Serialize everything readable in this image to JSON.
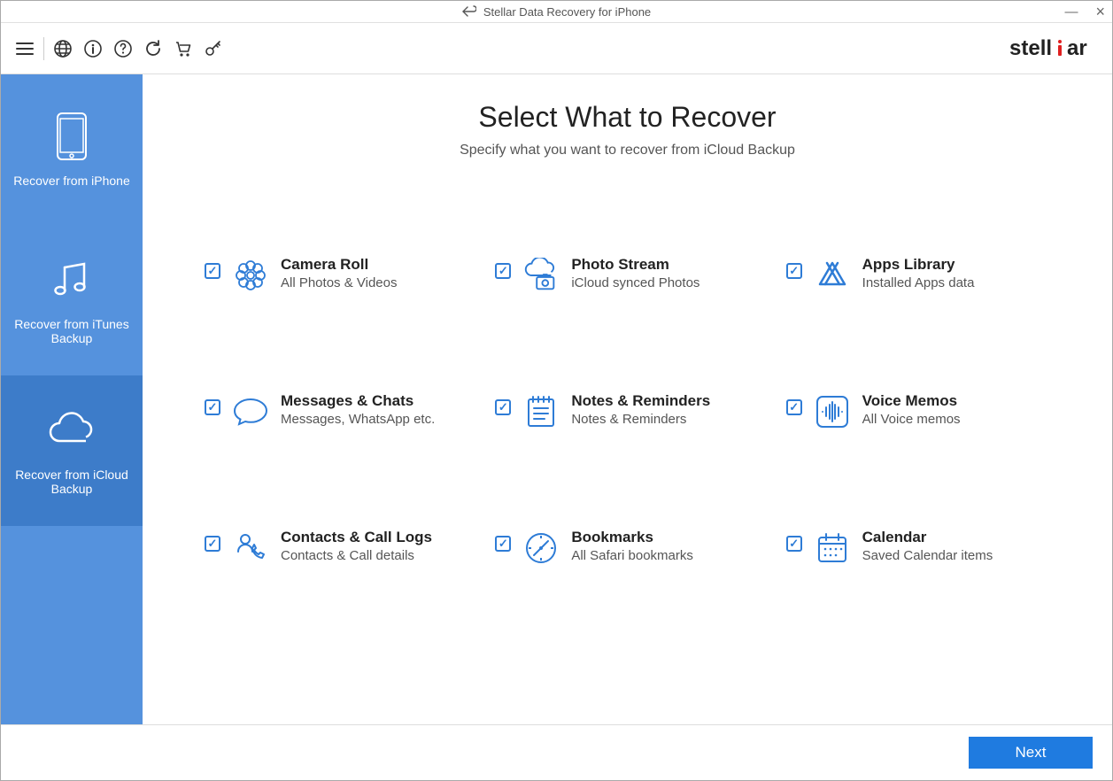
{
  "window": {
    "title": "Stellar Data Recovery for iPhone"
  },
  "brand": {
    "name": "stellar"
  },
  "sidebar": {
    "items": [
      {
        "label": "Recover from iPhone"
      },
      {
        "label": "Recover from iTunes Backup"
      },
      {
        "label": "Recover from iCloud Backup"
      }
    ]
  },
  "main": {
    "title": "Select What to Recover",
    "subtitle": "Specify what you want to recover from iCloud Backup"
  },
  "categories": [
    {
      "title": "Camera Roll",
      "sub": "All Photos & Videos",
      "checked": true
    },
    {
      "title": "Photo Stream",
      "sub": "iCloud synced Photos",
      "checked": true
    },
    {
      "title": "Apps Library",
      "sub": "Installed Apps data",
      "checked": true
    },
    {
      "title": "Messages & Chats",
      "sub": "Messages, WhatsApp etc.",
      "checked": true
    },
    {
      "title": "Notes & Reminders",
      "sub": "Notes & Reminders",
      "checked": true
    },
    {
      "title": "Voice Memos",
      "sub": "All Voice memos",
      "checked": true
    },
    {
      "title": "Contacts & Call Logs",
      "sub": "Contacts & Call details",
      "checked": true
    },
    {
      "title": "Bookmarks",
      "sub": "All Safari bookmarks",
      "checked": true
    },
    {
      "title": "Calendar",
      "sub": "Saved Calendar items",
      "checked": true
    }
  ],
  "footer": {
    "next": "Next"
  }
}
